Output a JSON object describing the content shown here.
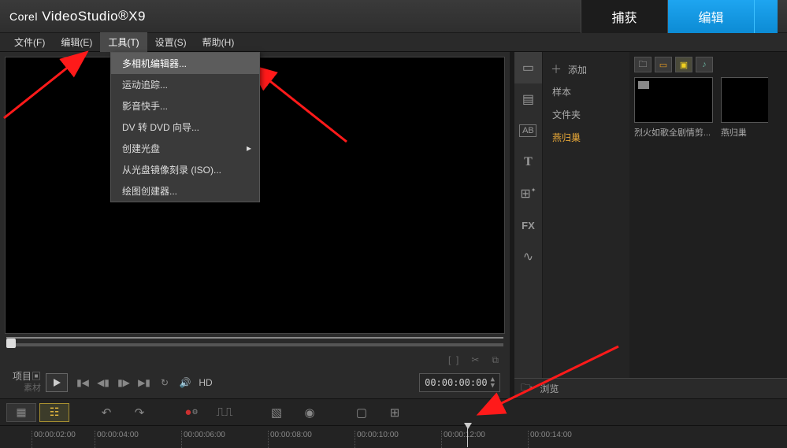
{
  "title": {
    "brand": "Corel",
    "product": "VideoStudio",
    "version": "X9"
  },
  "main_tabs": {
    "capture": "捕获",
    "edit": "编辑"
  },
  "menubar": {
    "file": "文件(F)",
    "edit": "编辑(E)",
    "tools": "工具(T)",
    "settings": "设置(S)",
    "help": "帮助(H)"
  },
  "tools_menu": {
    "multi_camera": "多相机编辑器...",
    "motion_tracking": "运动追踪...",
    "movie_wizard": "影音快手...",
    "dv_to_dvd": "DV 转 DVD 向导...",
    "create_disc": "创建光盘",
    "burn_iso": "从光盘镜像刻录 (ISO)...",
    "painting_creator": "绘图创建器..."
  },
  "preview": {
    "project_label": "项目",
    "material_label": "素材",
    "hd_label": "HD",
    "timecode": "00:00:00:00"
  },
  "sidebar_labels": {
    "film": "film-icon",
    "trans": "transition-icon",
    "ab": "AB",
    "t": "T",
    "poster": "poster-icon",
    "fx": "FX",
    "path": "path-icon"
  },
  "library": {
    "add_label": "添加",
    "sample_label": "样本",
    "folder_label": "文件夹",
    "selected_folder": "燕归巢",
    "thumb1_label": "烈火如歌全剧情剪...",
    "thumb2_label": "燕归巢",
    "browse_label": "浏览"
  },
  "timeline": {
    "marks": [
      "",
      "00:00:02:00",
      "00:00:04:00",
      "00:00:06:00",
      "00:00:08:00",
      "00:00:10:00",
      "00:00:12:00",
      "00:00:14:00"
    ]
  }
}
